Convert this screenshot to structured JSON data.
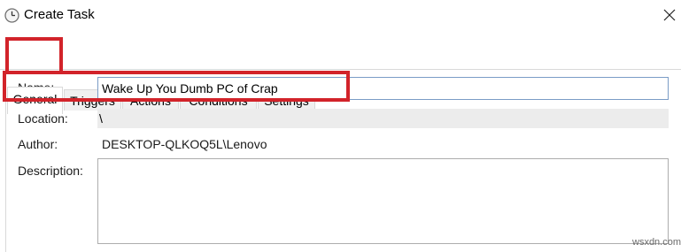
{
  "window": {
    "title": "Create Task",
    "icon": "clock-icon",
    "close_icon": "close-icon"
  },
  "tabs": [
    {
      "label": "General",
      "active": true
    },
    {
      "label": "Triggers",
      "active": false
    },
    {
      "label": "Actions",
      "active": false
    },
    {
      "label": "Conditions",
      "active": false
    },
    {
      "label": "Settings",
      "active": false
    }
  ],
  "form": {
    "name_label": "Name:",
    "name_value": "Wake Up You Dumb PC of Crap",
    "location_label": "Location:",
    "location_value": "\\",
    "author_label": "Author:",
    "author_value": "DESKTOP-QLKOQ5L\\Lenovo",
    "description_label": "Description:",
    "description_value": ""
  },
  "annotations": {
    "highlight_color": "#d2232a"
  },
  "watermark": "wsxdn.com"
}
